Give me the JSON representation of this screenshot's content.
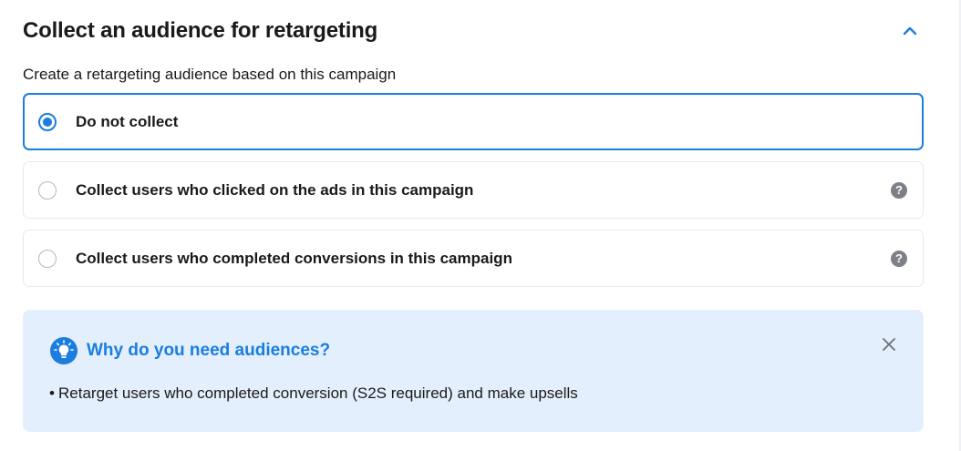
{
  "section": {
    "title": "Collect an audience for retargeting",
    "subtitle": "Create a retargeting audience based on this campaign"
  },
  "options": [
    {
      "label": "Do not collect",
      "selected": true,
      "has_help": false
    },
    {
      "label": "Collect users who clicked on the ads in this campaign",
      "selected": false,
      "has_help": true
    },
    {
      "label": "Collect users who completed conversions in this campaign",
      "selected": false,
      "has_help": true
    }
  ],
  "help_icon_glyph": "?",
  "info": {
    "title": "Why do you need audiences?",
    "bullet": "•",
    "items": [
      "Retarget users who completed conversion (S2S required) and make upsells"
    ]
  },
  "icons": {
    "collapse": "chevron-up-icon",
    "help": "question-circle-icon",
    "info": "lightbulb-icon",
    "close": "close-icon"
  },
  "colors": {
    "accent": "#1a7ddf",
    "info_background": "#e3effc",
    "border": "#e7e9ec",
    "help_icon": "#7d8187"
  }
}
